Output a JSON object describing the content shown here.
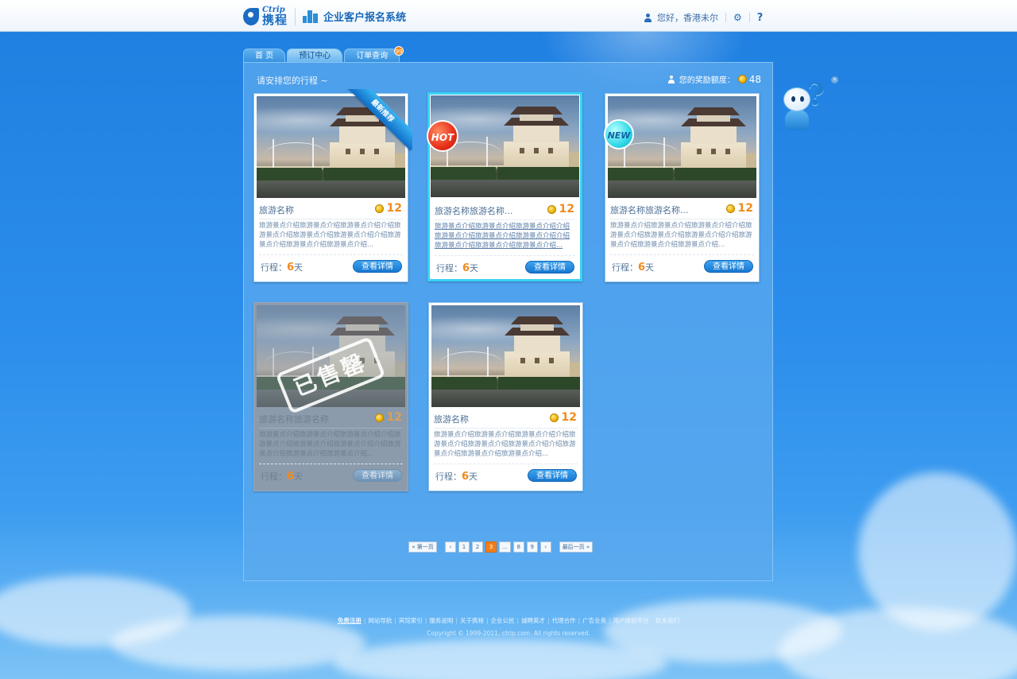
{
  "header": {
    "logo_en": "Ctrip",
    "logo_cn": "携程",
    "system_title": "企业客户报名系统",
    "greeting": "您好，香港未尔",
    "help": "?"
  },
  "tabs": [
    {
      "label": "首  页",
      "active": false
    },
    {
      "label": "预订中心",
      "active": true
    },
    {
      "label": "订单查询",
      "active": false,
      "badge": "99"
    }
  ],
  "panel": {
    "title": "请安排您的行程 ~",
    "bonus_label": "您的奖励额度：",
    "bonus_value": "48"
  },
  "cards": [
    {
      "name": "旅游名称",
      "price": "12",
      "desc": "旅游景点介绍旅游景点介绍旅游景点介绍介绍旅游景点介绍旅游景点介绍旅游景点介绍介绍旅游景点介绍旅游景点介绍旅游景点介绍...",
      "days_label": "行程：",
      "days": "6",
      "days_unit": "天",
      "button": "查看详情",
      "ribbon": "最新推荐",
      "state": "normal"
    },
    {
      "name": "旅游名称旅游名称...",
      "price": "12",
      "desc": "旅游景点介绍旅游景点介绍旅游景点介绍介绍旅游景点介绍旅游景点介绍旅游景点介绍介绍旅游景点介绍旅游景点介绍旅游景点介绍...",
      "days_label": "行程：",
      "days": "6",
      "days_unit": "天",
      "button": "查看详情",
      "badge": "HOT",
      "state": "highlight"
    },
    {
      "name": "旅游名称旅游名称...",
      "price": "12",
      "desc": "旅游景点介绍旅游景点介绍旅游景点介绍介绍旅游景点介绍旅游景点介绍旅游景点介绍介绍旅游景点介绍旅游景点介绍旅游景点介绍...",
      "days_label": "行程：",
      "days": "6",
      "days_unit": "天",
      "button": "查看详情",
      "badge": "NEW",
      "state": "normal"
    },
    {
      "name": "旅游名称旅游名称",
      "price": "12",
      "desc": "旅游景点介绍旅游景点介绍旅游景点介绍介绍旅游景点介绍旅游景点介绍旅游景点介绍介绍旅游景点介绍旅游景点介绍旅游景点介绍...",
      "days_label": "行程：",
      "days": "6",
      "days_unit": "天",
      "button": "查看详情",
      "stamp": "已售罄",
      "state": "soldout"
    },
    {
      "name": "旅游名称",
      "price": "12",
      "desc": "旅游景点介绍旅游景点介绍旅游景点介绍介绍旅游景点介绍旅游景点介绍旅游景点介绍介绍旅游景点介绍旅游景点介绍旅游景点介绍...",
      "days_label": "行程：",
      "days": "6",
      "days_unit": "天",
      "button": "查看详情",
      "state": "normal"
    }
  ],
  "pager": {
    "first": "« 第一页",
    "prev": "‹",
    "pages": [
      "1",
      "2",
      "3",
      "...",
      "8",
      "9"
    ],
    "current": "3",
    "next": "›",
    "last": "最后一页 »"
  },
  "footer": {
    "links": [
      "免费注册",
      "网站导航",
      "宾馆索引",
      "服务说明",
      "关于携程",
      "企业公民",
      "诚聘英才",
      "代理合作",
      "广告业务",
      "用户体验平台",
      "联系我们"
    ],
    "copyright": "Copyright © 1999-2011, ctrip.com. All rights reserved."
  },
  "colors": {
    "accent": "#f08a1c",
    "brand": "#1a6cc4",
    "highlight_border": "#36d3f4"
  }
}
